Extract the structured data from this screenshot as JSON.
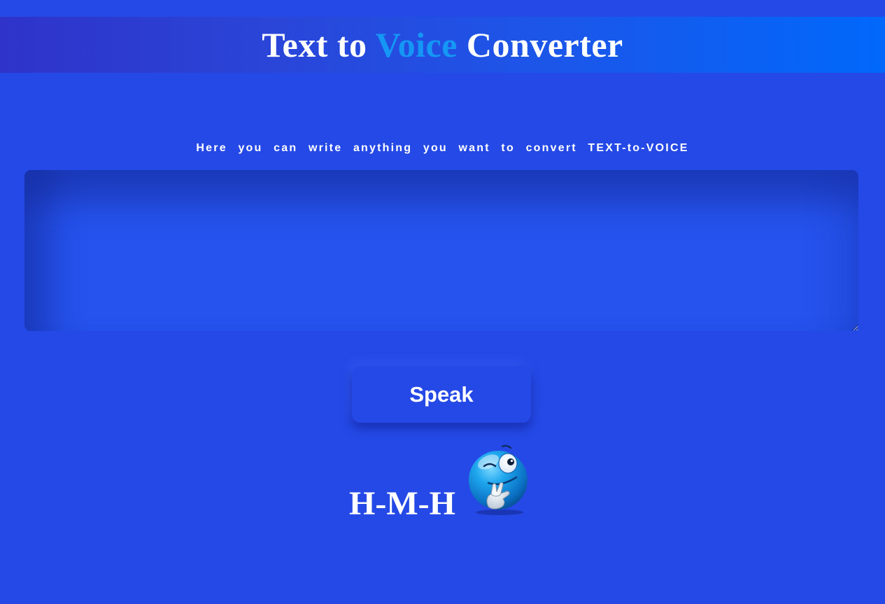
{
  "header": {
    "title_part1": "Text to ",
    "title_accent": "Voice",
    "title_part2": " Converter",
    "accent_color": "#1597f5"
  },
  "instruction": "Here you can write anything you want to convert TEXT-to-VOICE",
  "text_input": {
    "value": "",
    "placeholder": ""
  },
  "speak_button": {
    "label": "Speak"
  },
  "footer": {
    "signature": "H-M-H",
    "emoji_icon": "winking-smiley-icon"
  },
  "colors": {
    "background": "#2549e6",
    "header_gradient_start": "#2f33c9",
    "header_gradient_end": "#0068fb"
  }
}
